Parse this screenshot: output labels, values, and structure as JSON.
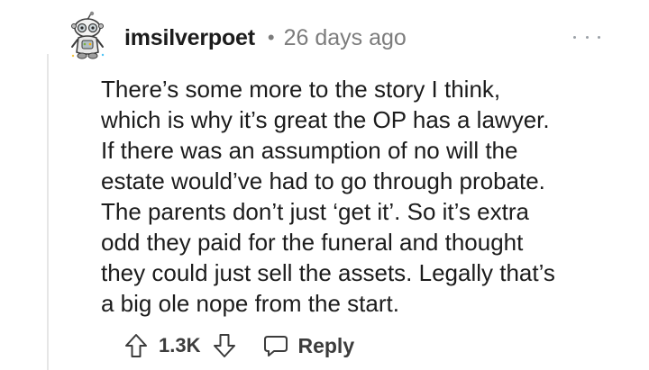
{
  "comment": {
    "username": "imsilverpoet",
    "separator": "•",
    "timestamp": "26 days ago",
    "body_lines": [
      "There’s some more to the story I think,",
      "which is why it’s great the OP has a lawyer.",
      "If there was an assumption of no will the",
      "estate would’ve had to go through probate.",
      "The parents don’t just ‘get it’. So it’s extra",
      "odd they paid for the funeral and thought",
      "they could just sell the assets. Legally that’s",
      "a big ole nope from the start."
    ],
    "vote_count": "1.3K",
    "reply_label": "Reply"
  },
  "icons": {
    "avatar": "snoo-avatar-icon",
    "more": "more-options-icon",
    "upvote": "upvote-arrow-icon",
    "downvote": "downvote-arrow-icon",
    "reply": "speech-bubble-icon"
  },
  "colors": {
    "text": "#1c1c1c",
    "meta": "#7c7c7c",
    "action": "#3c3c3c",
    "thread_line": "#e6e6e6"
  }
}
